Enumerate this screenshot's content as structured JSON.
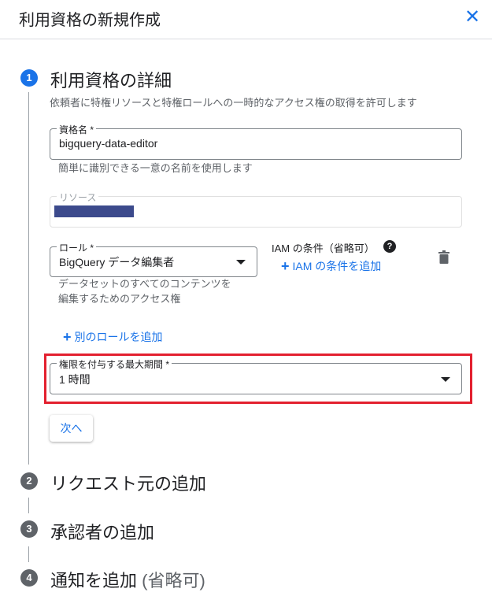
{
  "header": {
    "title": "利用資格の新規作成",
    "close_icon": "close-icon"
  },
  "steps": [
    {
      "number": "1",
      "title": "利用資格の詳細",
      "state": "active"
    },
    {
      "number": "2",
      "title": "リクエスト元の追加",
      "state": "inactive"
    },
    {
      "number": "3",
      "title": "承認者の追加",
      "state": "inactive"
    },
    {
      "number": "4",
      "title": "通知を追加",
      "optional": "(省略可)",
      "state": "inactive"
    }
  ],
  "details": {
    "description": "依頼者に特権リソースと特権ロールへの一時的なアクセス権の取得を許可します",
    "name_field": {
      "label": "資格名 *",
      "value": "bigquery-data-editor",
      "helper": "簡単に識別できる一意の名前を使用します"
    },
    "resource_field": {
      "label": "リソース",
      "value_redacted": true
    },
    "role_field": {
      "label": "ロール *",
      "value": "BigQuery データ編集者",
      "helper_line1": "データセットのすべてのコンテンツを",
      "helper_line2": "編集するためのアクセス権"
    },
    "iam_condition": {
      "label": "IAM の条件（省略可）",
      "help_icon": "help-icon",
      "add_label": "IAM の条件を追加"
    },
    "delete_icon": "trash-icon",
    "add_role_label": "別のロールを追加",
    "duration_field": {
      "label": "権限を付与する最大期間 *",
      "value": "1 時間"
    },
    "next_label": "次へ"
  },
  "colors": {
    "accent": "#1a73e8",
    "highlight": "#e3202f",
    "redaction": "#3c4a8c"
  }
}
